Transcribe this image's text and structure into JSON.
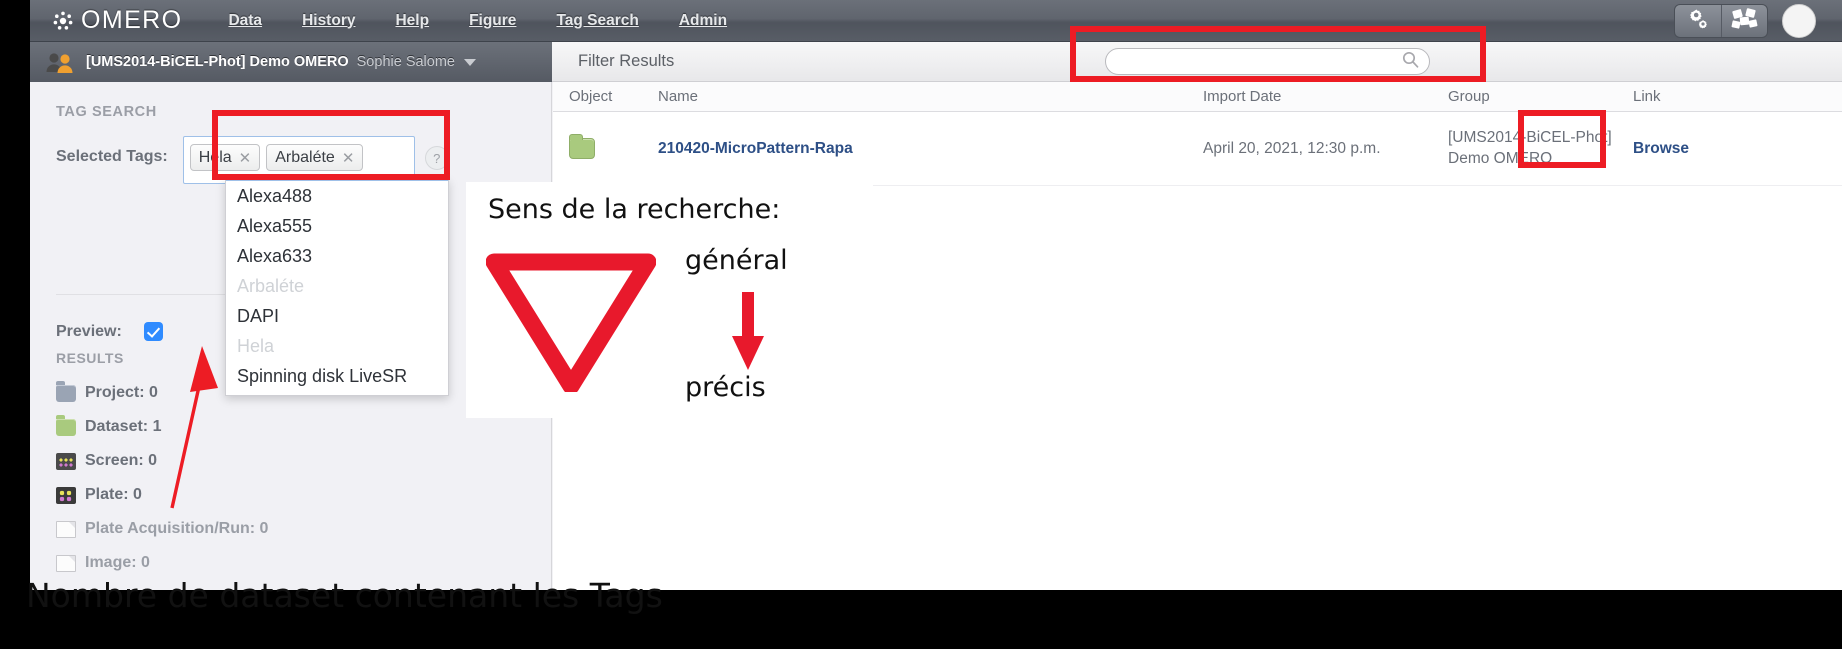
{
  "app": {
    "brand": "OMERO",
    "nav": [
      "Data",
      "History",
      "Help",
      "Figure",
      "Tag Search",
      "Admin"
    ],
    "tools": {
      "settings_icon": "gears-icon",
      "images_icon": "scattered-squares-icon",
      "avatar": "user-avatar"
    }
  },
  "userbar": {
    "group": "[UMS2014-BiCEL-Phot] Demo OMERO",
    "user": "Sophie Salome",
    "caret_icon": "chevron-down-icon"
  },
  "filterbar": {
    "label": "Filter Results",
    "search_value": "",
    "search_placeholder": "",
    "search_icon": "search-icon"
  },
  "left": {
    "section_title": "TAG SEARCH",
    "selected_label": "Selected Tags:",
    "selected_tags": [
      "Hela",
      "Arbaléte"
    ],
    "remove_icon": "close-x-icon",
    "help_label": "?",
    "preview_label": "Preview:",
    "preview_checked": true,
    "results_title": "RESULTS",
    "results": [
      {
        "label": "Project: 0",
        "icon": "folder-blue-icon",
        "dim": false
      },
      {
        "label": "Dataset: 1",
        "icon": "folder-green-icon",
        "dim": false
      },
      {
        "label": "Screen: 0",
        "icon": "screen-icon",
        "dim": false
      },
      {
        "label": "Plate: 0",
        "icon": "plate-icon",
        "dim": false
      },
      {
        "label": "Plate Acquisition/Run: 0",
        "icon": "document-icon",
        "dim": true
      },
      {
        "label": "Image: 0",
        "icon": "document-icon",
        "dim": true
      }
    ]
  },
  "dropdown": {
    "items": [
      {
        "label": "Alexa488",
        "disabled": false
      },
      {
        "label": "Alexa555",
        "disabled": false
      },
      {
        "label": "Alexa633",
        "disabled": false
      },
      {
        "label": "Arbaléte",
        "disabled": true
      },
      {
        "label": "DAPI",
        "disabled": false
      },
      {
        "label": "Hela",
        "disabled": true
      },
      {
        "label": "Spinning disk LiveSR",
        "disabled": false
      }
    ]
  },
  "table": {
    "headers": [
      "Object",
      "Name",
      "Import Date",
      "Group",
      "Link"
    ],
    "rows": [
      {
        "object_icon": "folder-green-icon",
        "name": "210420-MicroPattern-Rapa",
        "date": "April 20, 2021, 12:30 p.m.",
        "group": "[UMS2014-BiCEL-Phot] Demo OMERO",
        "link": "Browse"
      }
    ]
  },
  "annotation": {
    "title": "Sens de la recherche:",
    "from": "général",
    "to": "précis",
    "triangle_icon": "red-triangle-outline-icon",
    "arrow_icon": "red-down-arrow-icon"
  },
  "caption": "Nombre de dataset contenant les Tags",
  "pointer": {
    "icon": "red-arrow-up-icon"
  },
  "colors": {
    "highlight_red": "#ed1c24",
    "accent_blue": "#2d4f86",
    "checkbox_blue": "#2f8bff",
    "folder_green": "#a9ca7e",
    "folder_blue": "#9aa4b4"
  }
}
